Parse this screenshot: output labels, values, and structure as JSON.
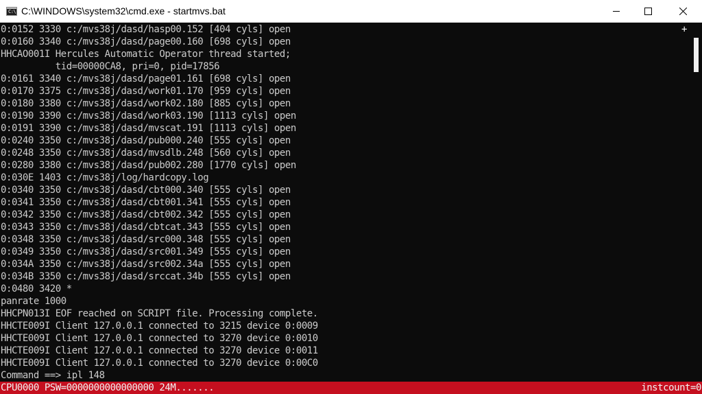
{
  "window": {
    "title": "C:\\WINDOWS\\system32\\cmd.exe - startmvs.bat",
    "icon_label": "C:\\"
  },
  "terminal": {
    "lines": [
      "0:0152 3330 c:/mvs38j/dasd/hasp00.152 [404 cyls] open",
      "0:0160 3340 c:/mvs38j/dasd/page00.160 [698 cyls] open",
      "HHCAO001I Hercules Automatic Operator thread started;",
      "          tid=00000CA8, pri=0, pid=17856",
      "0:0161 3340 c:/mvs38j/dasd/page01.161 [698 cyls] open",
      "0:0170 3375 c:/mvs38j/dasd/work01.170 [959 cyls] open",
      "0:0180 3380 c:/mvs38j/dasd/work02.180 [885 cyls] open",
      "0:0190 3390 c:/mvs38j/dasd/work03.190 [1113 cyls] open",
      "0:0191 3390 c:/mvs38j/dasd/mvscat.191 [1113 cyls] open",
      "0:0240 3350 c:/mvs38j/dasd/pub000.240 [555 cyls] open",
      "0:0248 3350 c:/mvs38j/dasd/mvsdlb.248 [560 cyls] open",
      "0:0280 3380 c:/mvs38j/dasd/pub002.280 [1770 cyls] open",
      "0:030E 1403 c:/mvs38j/log/hardcopy.log",
      "0:0340 3350 c:/mvs38j/dasd/cbt000.340 [555 cyls] open",
      "0:0341 3350 c:/mvs38j/dasd/cbt001.341 [555 cyls] open",
      "0:0342 3350 c:/mvs38j/dasd/cbt002.342 [555 cyls] open",
      "0:0343 3350 c:/mvs38j/dasd/cbtcat.343 [555 cyls] open",
      "0:0348 3350 c:/mvs38j/dasd/src000.348 [555 cyls] open",
      "0:0349 3350 c:/mvs38j/dasd/src001.349 [555 cyls] open",
      "0:034A 3350 c:/mvs38j/dasd/src002.34a [555 cyls] open",
      "0:034B 3350 c:/mvs38j/dasd/srccat.34b [555 cyls] open",
      "0:0480 3420 *",
      "panrate 1000",
      "HHCPN013I EOF reached on SCRIPT file. Processing complete.",
      "HHCTE009I Client 127.0.0.1 connected to 3215 device 0:0009",
      "HHCTE009I Client 127.0.0.1 connected to 3270 device 0:0010",
      "HHCTE009I Client 127.0.0.1 connected to 3270 device 0:0011",
      "HHCTE009I Client 127.0.0.1 connected to 3270 device 0:00C0",
      "Command ==> ipl 148"
    ],
    "scroll_marker": "+"
  },
  "status": {
    "left": "CPU0000 PSW=0000000000000000 24M.......",
    "right": "instcount=0"
  },
  "colors": {
    "terminal_bg": "#0c0c0c",
    "terminal_fg": "#cccccc",
    "status_bg": "#c50f1f",
    "status_fg": "#f2f2f2"
  }
}
